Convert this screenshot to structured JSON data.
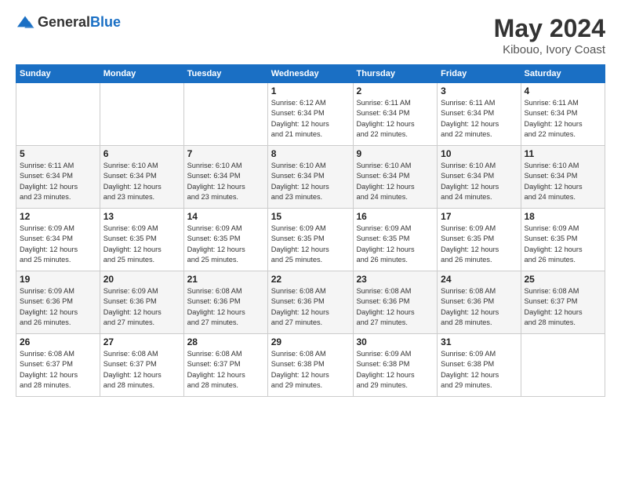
{
  "logo": {
    "general": "General",
    "blue": "Blue"
  },
  "title": "May 2024",
  "subtitle": "Kibouo, Ivory Coast",
  "days_header": [
    "Sunday",
    "Monday",
    "Tuesday",
    "Wednesday",
    "Thursday",
    "Friday",
    "Saturday"
  ],
  "weeks": [
    [
      {
        "num": "",
        "info": ""
      },
      {
        "num": "",
        "info": ""
      },
      {
        "num": "",
        "info": ""
      },
      {
        "num": "1",
        "info": "Sunrise: 6:12 AM\nSunset: 6:34 PM\nDaylight: 12 hours\nand 21 minutes."
      },
      {
        "num": "2",
        "info": "Sunrise: 6:11 AM\nSunset: 6:34 PM\nDaylight: 12 hours\nand 22 minutes."
      },
      {
        "num": "3",
        "info": "Sunrise: 6:11 AM\nSunset: 6:34 PM\nDaylight: 12 hours\nand 22 minutes."
      },
      {
        "num": "4",
        "info": "Sunrise: 6:11 AM\nSunset: 6:34 PM\nDaylight: 12 hours\nand 22 minutes."
      }
    ],
    [
      {
        "num": "5",
        "info": "Sunrise: 6:11 AM\nSunset: 6:34 PM\nDaylight: 12 hours\nand 23 minutes."
      },
      {
        "num": "6",
        "info": "Sunrise: 6:10 AM\nSunset: 6:34 PM\nDaylight: 12 hours\nand 23 minutes."
      },
      {
        "num": "7",
        "info": "Sunrise: 6:10 AM\nSunset: 6:34 PM\nDaylight: 12 hours\nand 23 minutes."
      },
      {
        "num": "8",
        "info": "Sunrise: 6:10 AM\nSunset: 6:34 PM\nDaylight: 12 hours\nand 23 minutes."
      },
      {
        "num": "9",
        "info": "Sunrise: 6:10 AM\nSunset: 6:34 PM\nDaylight: 12 hours\nand 24 minutes."
      },
      {
        "num": "10",
        "info": "Sunrise: 6:10 AM\nSunset: 6:34 PM\nDaylight: 12 hours\nand 24 minutes."
      },
      {
        "num": "11",
        "info": "Sunrise: 6:10 AM\nSunset: 6:34 PM\nDaylight: 12 hours\nand 24 minutes."
      }
    ],
    [
      {
        "num": "12",
        "info": "Sunrise: 6:09 AM\nSunset: 6:34 PM\nDaylight: 12 hours\nand 25 minutes."
      },
      {
        "num": "13",
        "info": "Sunrise: 6:09 AM\nSunset: 6:35 PM\nDaylight: 12 hours\nand 25 minutes."
      },
      {
        "num": "14",
        "info": "Sunrise: 6:09 AM\nSunset: 6:35 PM\nDaylight: 12 hours\nand 25 minutes."
      },
      {
        "num": "15",
        "info": "Sunrise: 6:09 AM\nSunset: 6:35 PM\nDaylight: 12 hours\nand 25 minutes."
      },
      {
        "num": "16",
        "info": "Sunrise: 6:09 AM\nSunset: 6:35 PM\nDaylight: 12 hours\nand 26 minutes."
      },
      {
        "num": "17",
        "info": "Sunrise: 6:09 AM\nSunset: 6:35 PM\nDaylight: 12 hours\nand 26 minutes."
      },
      {
        "num": "18",
        "info": "Sunrise: 6:09 AM\nSunset: 6:35 PM\nDaylight: 12 hours\nand 26 minutes."
      }
    ],
    [
      {
        "num": "19",
        "info": "Sunrise: 6:09 AM\nSunset: 6:36 PM\nDaylight: 12 hours\nand 26 minutes."
      },
      {
        "num": "20",
        "info": "Sunrise: 6:09 AM\nSunset: 6:36 PM\nDaylight: 12 hours\nand 27 minutes."
      },
      {
        "num": "21",
        "info": "Sunrise: 6:08 AM\nSunset: 6:36 PM\nDaylight: 12 hours\nand 27 minutes."
      },
      {
        "num": "22",
        "info": "Sunrise: 6:08 AM\nSunset: 6:36 PM\nDaylight: 12 hours\nand 27 minutes."
      },
      {
        "num": "23",
        "info": "Sunrise: 6:08 AM\nSunset: 6:36 PM\nDaylight: 12 hours\nand 27 minutes."
      },
      {
        "num": "24",
        "info": "Sunrise: 6:08 AM\nSunset: 6:36 PM\nDaylight: 12 hours\nand 28 minutes."
      },
      {
        "num": "25",
        "info": "Sunrise: 6:08 AM\nSunset: 6:37 PM\nDaylight: 12 hours\nand 28 minutes."
      }
    ],
    [
      {
        "num": "26",
        "info": "Sunrise: 6:08 AM\nSunset: 6:37 PM\nDaylight: 12 hours\nand 28 minutes."
      },
      {
        "num": "27",
        "info": "Sunrise: 6:08 AM\nSunset: 6:37 PM\nDaylight: 12 hours\nand 28 minutes."
      },
      {
        "num": "28",
        "info": "Sunrise: 6:08 AM\nSunset: 6:37 PM\nDaylight: 12 hours\nand 28 minutes."
      },
      {
        "num": "29",
        "info": "Sunrise: 6:08 AM\nSunset: 6:38 PM\nDaylight: 12 hours\nand 29 minutes."
      },
      {
        "num": "30",
        "info": "Sunrise: 6:09 AM\nSunset: 6:38 PM\nDaylight: 12 hours\nand 29 minutes."
      },
      {
        "num": "31",
        "info": "Sunrise: 6:09 AM\nSunset: 6:38 PM\nDaylight: 12 hours\nand 29 minutes."
      },
      {
        "num": "",
        "info": ""
      }
    ]
  ]
}
